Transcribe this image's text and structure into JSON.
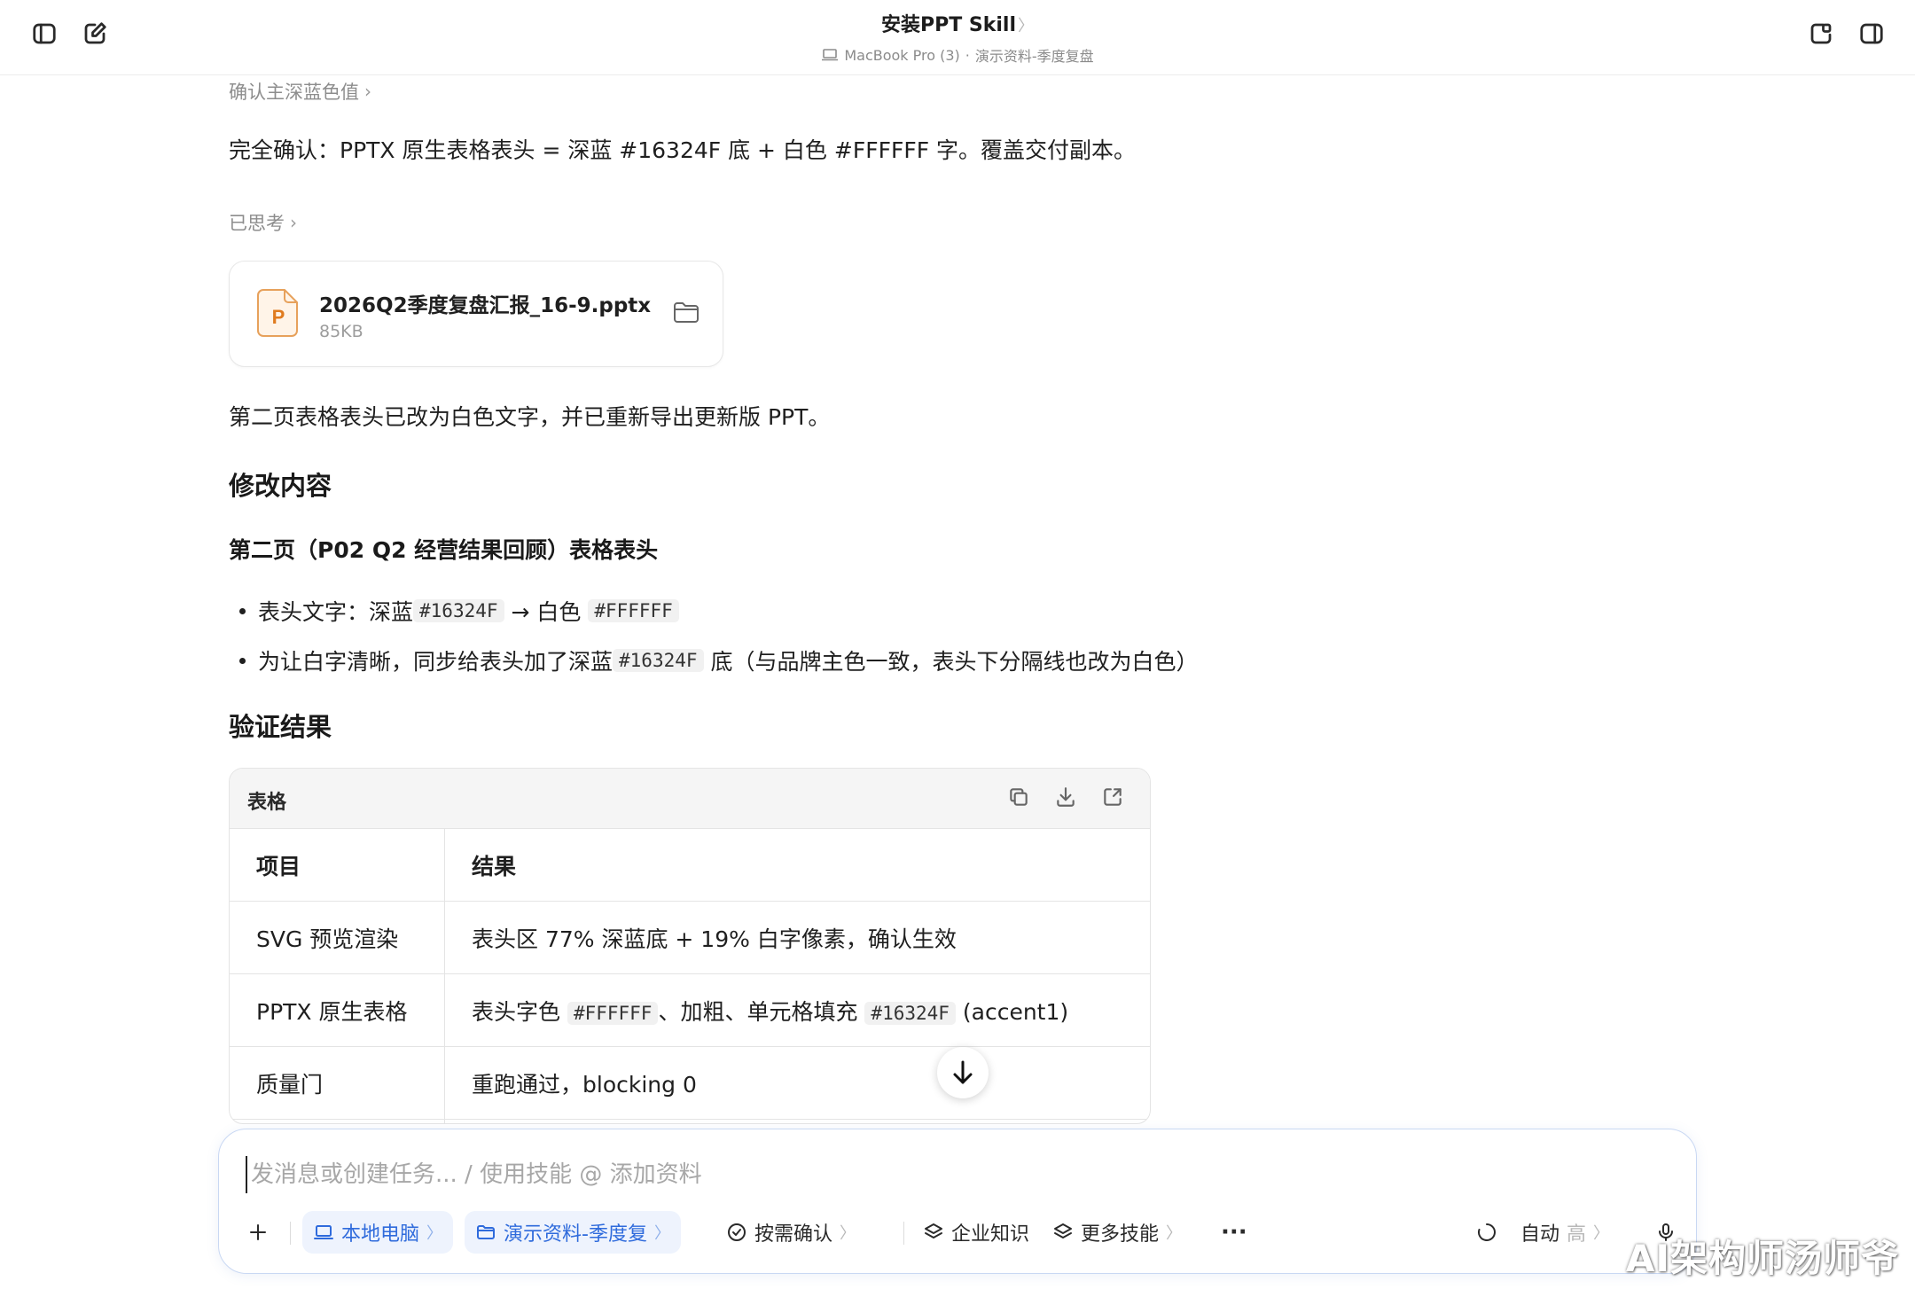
{
  "header": {
    "title": "安装PPT Skill",
    "title_chevron": "〉",
    "device": "MacBook Pro (3)",
    "separator": "·",
    "project": "演示资料-季度复盘"
  },
  "content": {
    "collapsed_thought_1": "确认主深蓝色值",
    "confirm_text": "完全确认：PPTX 原生表格表头 = 深蓝 #16324F 底 + 白色 #FFFFFF 字。覆盖交付副本。",
    "collapsed_thought_2": "已思考",
    "file": {
      "name": "2026Q2季度复盘汇报_16-9.pptx",
      "size": "85KB",
      "icon_letter": "P"
    },
    "summary": "第二页表格表头已改为白色文字，并已重新导出更新版 PPT。",
    "h_changes": "修改内容",
    "h_page2": "第二页（P02 Q2 经营结果回顾）表格表头",
    "bullet1": {
      "prefix": "表头文字：深蓝 ",
      "code1": "#16324F",
      "mid": " → 白色 ",
      "code2": "#FFFFFF"
    },
    "bullet2": {
      "prefix": "为让白字清晰，同步给表头加了深蓝 ",
      "code1": "#16324F",
      "suffix": " 底（与品牌主色一致，表头下分隔线也改为白色）"
    },
    "h_verify": "验证结果"
  },
  "table": {
    "label": "表格",
    "headers": [
      "项目",
      "结果"
    ],
    "rows": [
      {
        "item": "SVG 预览渲染",
        "result": "表头区 77% 深蓝底 + 19% 白字像素，确认生效"
      },
      {
        "item": "PPTX 原生表格",
        "r_a": "表头字色 ",
        "r_code1": "#FFFFFF",
        "r_b": "、加粗、单元格填充 ",
        "r_code2": "#16324F",
        "r_c": " (accent1)"
      },
      {
        "item": "质量门",
        "result": "重跑通过，blocking 0"
      }
    ]
  },
  "composer": {
    "placeholder": "发消息或创建任务... / 使用技能 @ 添加资料",
    "local_pc": "本地电脑",
    "project_chip": "演示资料-季度复",
    "confirm_mode": "按需确认",
    "enterprise_knowledge": "企业知识",
    "more_skills": "更多技能",
    "more": "···",
    "model_mode": "自动",
    "model_level": "高"
  },
  "watermark": "AI架构师汤师爷",
  "colors": {
    "accent": "#2f6bdc",
    "pptx_orange": "#e07b1f",
    "chip_bg": "#eef3fd"
  },
  "icons": [
    "sidebar-toggle-icon",
    "new-chat-icon",
    "laptop-icon",
    "new-window-icon",
    "right-panel-icon",
    "folder-icon",
    "copy-icon",
    "download-icon",
    "expand-icon",
    "arrow-down-icon",
    "plus-icon",
    "shield-check-icon",
    "layers-icon",
    "microphone-icon",
    "spinner-icon"
  ]
}
